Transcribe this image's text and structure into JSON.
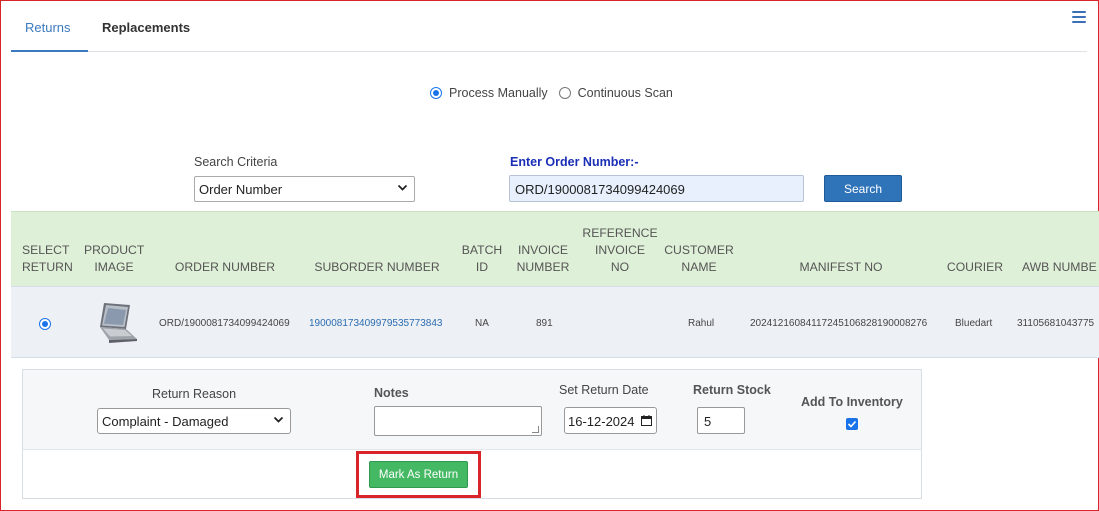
{
  "tabs": [
    {
      "label": "Returns",
      "active": true
    },
    {
      "label": "Replacements",
      "active": false
    }
  ],
  "mode": {
    "options": [
      "Process Manually",
      "Continuous Scan"
    ],
    "selected": "Process Manually"
  },
  "search": {
    "criteria_label": "Search Criteria",
    "criteria_value": "Order Number",
    "order_label": "Enter Order Number:-",
    "order_value": "ORD/1900081734099424069",
    "button_label": "Search"
  },
  "table": {
    "headers": {
      "select_return": [
        "SELECT",
        "RETURN"
      ],
      "product_image": [
        "PRODUCT",
        "IMAGE"
      ],
      "order_number": "ORDER NUMBER",
      "suborder_number": "SUBORDER NUMBER",
      "batch_id": [
        "BATCH",
        "ID"
      ],
      "invoice_number": [
        "INVOICE",
        "NUMBER"
      ],
      "reference_invoice": [
        "REFERENCE",
        "INVOICE",
        "NO"
      ],
      "customer_name": [
        "CUSTOMER",
        "NAME"
      ],
      "manifest_no": "MANIFEST NO",
      "courier": "COURIER",
      "awb_number": "AWB NUMBE"
    },
    "row": {
      "selected": true,
      "order_number": "ORD/1900081734099424069",
      "suborder_number": "19000817340997953577384З",
      "batch_id": "NA",
      "invoice_number": "891",
      "reference_invoice": "",
      "customer_name": "Rahul",
      "manifest_no": "20241216084117245106828190008276",
      "courier": "Bluedart",
      "awb_number": "31105681043775"
    }
  },
  "return_form": {
    "reason_label": "Return Reason",
    "reason_value": "Complaint - Damaged",
    "notes_label": "Notes",
    "notes_value": "",
    "date_label": "Set Return Date",
    "date_value": "16-12-2024",
    "stock_label": "Return Stock",
    "stock_value": "5",
    "inventory_label": "Add To Inventory",
    "inventory_checked": true,
    "mark_button_label": "Mark As Return"
  },
  "colors": {
    "accent": "#2f73b8",
    "header_bg": "#dff0d8",
    "success": "#45b864",
    "highlight": "#d9252a"
  }
}
